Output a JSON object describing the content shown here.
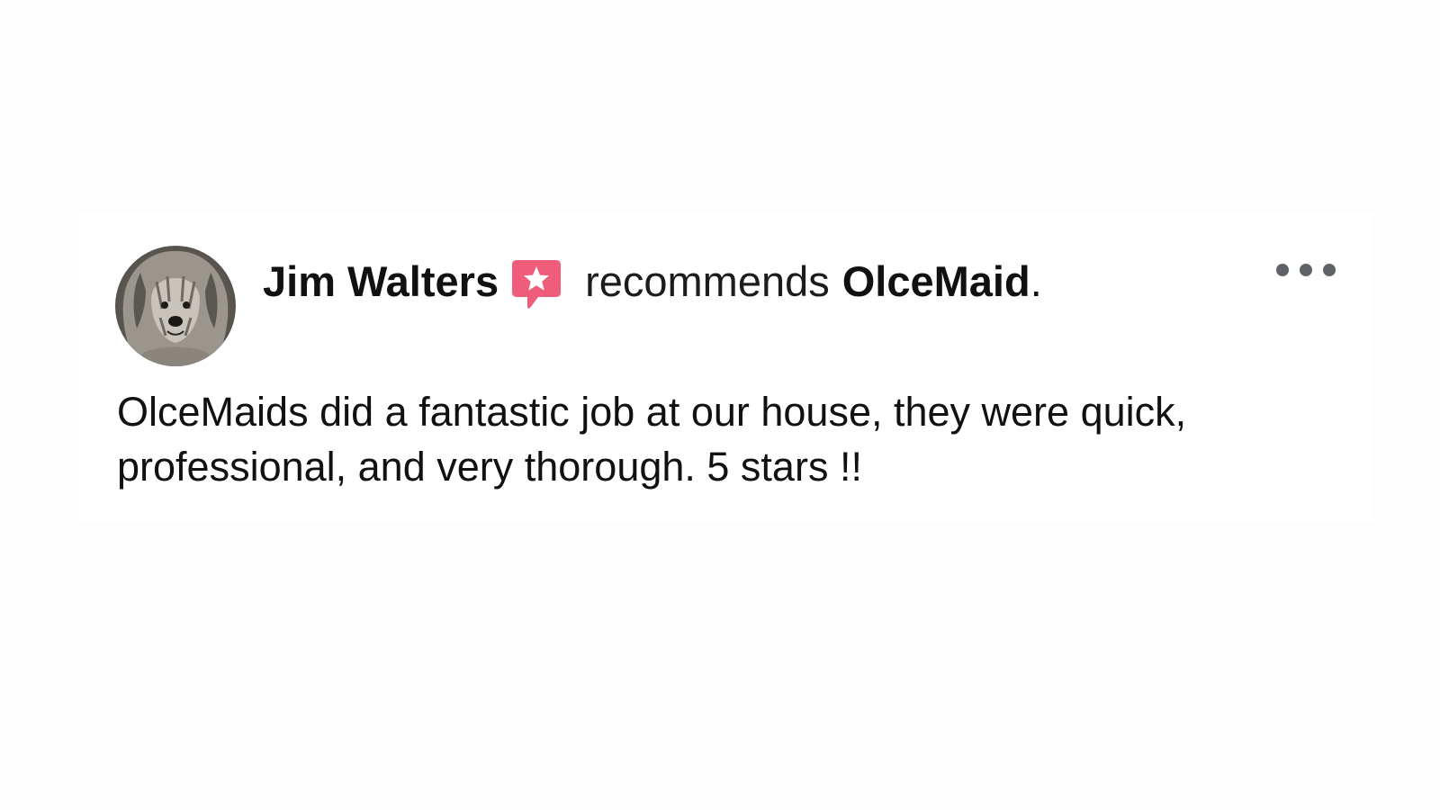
{
  "post": {
    "author_name": "Jim Walters",
    "recommendation_icon": "recommendation-star-icon",
    "recommends_text": "recommends",
    "page_name": "OlceMaid",
    "period": ".",
    "more_icon": "more-options-icon",
    "review_text": "OlceMaids did a fantastic job at our house, they were quick, professional, and very thorough. 5 stars !!"
  },
  "colors": {
    "background": "#fdfdfd",
    "card": "#ffffff",
    "text": "#111111",
    "recommend_badge": "#ef5d7a",
    "more_dots": "#5f6368"
  }
}
